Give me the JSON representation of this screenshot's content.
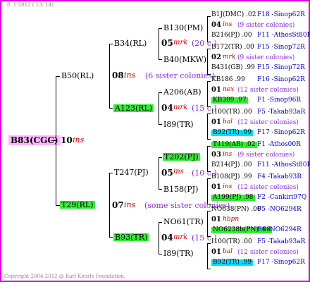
{
  "header": "8. 1-2012 ( 13: 14)",
  "footer": "Copyright 2004-2012 @ Karl Kehrle Foundation.",
  "root": {
    "label": "B83(CGC)",
    "num": "10",
    "mark": "ins"
  },
  "gen1": [
    {
      "label": "B50(RL)",
      "num": "08",
      "mark": "ins",
      "note": "(6 sister colonies)"
    },
    {
      "label": "T29(RL)",
      "num": "07",
      "mark": "ins",
      "note": "(some sister colonies)"
    }
  ],
  "gen2": [
    {
      "label": "B34(RL)",
      "num": "05",
      "mark": "mrk",
      "note": "(20 c.)"
    },
    {
      "label": "A123(RL)",
      "num": "04",
      "mark": "mrk",
      "note": "(15 c.)"
    },
    {
      "label": "T247(PJ)",
      "num": "05",
      "mark": "ins",
      "note": "(10 c.)"
    },
    {
      "label": "B93(TR)",
      "num": "04",
      "mark": "mrk",
      "note": "(15 c.)"
    }
  ],
  "gen3": [
    "B130(PM)",
    "B40(MKW)",
    "A206(AB)",
    "I89(TR)",
    "T202(PJ)",
    "B158(PJ)",
    "NO61(TR)",
    "I89(TR)"
  ],
  "gen3_detail": [
    {
      "top": "B1J(DMC) .02",
      "top_right": "F18 -Sinop62R",
      "num": "04",
      "mark": "ins",
      "note": "(9 sister colonies)",
      "bot": "B216(PJ) .00",
      "bot_right": "F11 -AthosSt80R"
    },
    {
      "top": "B172(TR) .00",
      "top_right": "F15 -Sinop72R",
      "num": "02",
      "mark": "mrk",
      "note": "(9 sister colonies)",
      "bot": "B431(GB) .99",
      "bot_right": "F15 -Sinop72R"
    },
    {
      "top": "KB186 .99",
      "top_right": "F16 -Sinop62R",
      "num": "01",
      "mark": "nex",
      "note": "(12 sister colonies)",
      "bot": "KB309 .97",
      "bot_right": "F1 -Sinop96R"
    },
    {
      "top": "I100(TR) .00",
      "top_right": "F5 -Takab93aR",
      "num": "01",
      "mark": "bal",
      "note": "(12 sister colonies)",
      "bot": "B92(TR) .99",
      "bot_right": "F17 -Sinop62R"
    },
    {
      "top": "T419(AB) .02",
      "top_right": "F1 -Athos00R",
      "num": "03",
      "mark": "ins",
      "note": "(9 sister colonies)",
      "bot": "B214(PJ) .00",
      "bot_right": "F11 -AthosSt80R"
    },
    {
      "top": "B108(PJ) .99",
      "top_right": "F4 -Takab93R",
      "num": "01",
      "mark": "ins",
      "note": "(12 sister colonies)",
      "bot": "A199(PJ) .98",
      "bot_right": "F2 -Cankiri97Q"
    },
    {
      "top": "NO638(PN) .00",
      "top_right": "F5 -NO6294R",
      "num": "01",
      "mark": "hbpn",
      "note": "",
      "bot": "NO6238b(PN) .98",
      "bot_right": "F4 -NO6294R"
    },
    {
      "top": "I100(TR) .00",
      "top_right": "F5 -Takab93aR",
      "num": "01",
      "mark": "bal",
      "note": "(12 sister colonies)",
      "bot": "B92(TR) .99",
      "bot_right": "F17 -Sinop62R"
    }
  ]
}
